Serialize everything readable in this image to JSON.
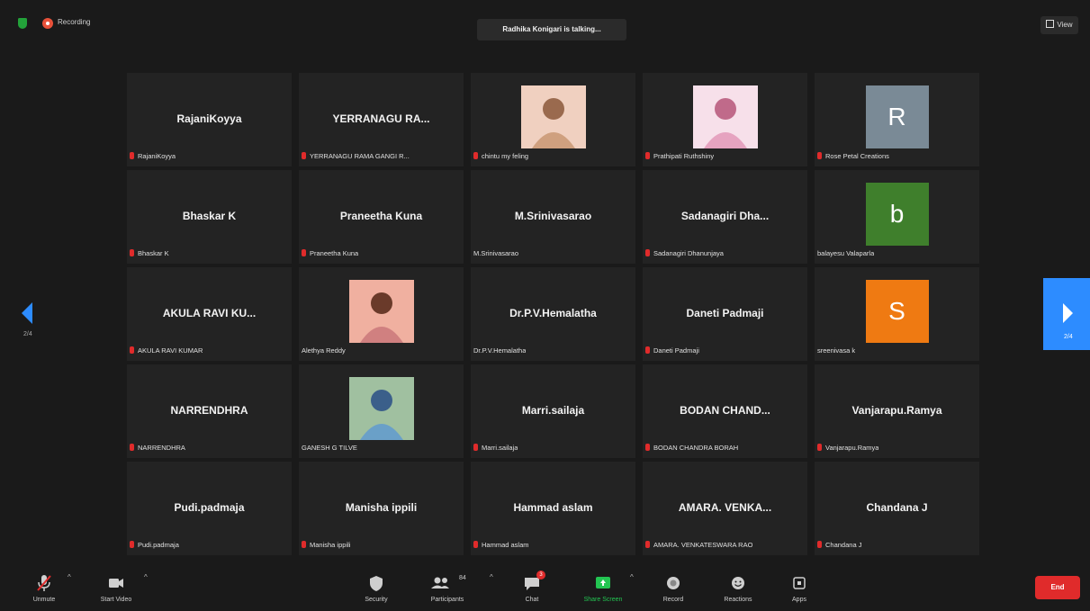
{
  "topbar": {
    "recording_label": "Recording",
    "talking_label": "Radhika Konigari is talking...",
    "view_label": "View"
  },
  "navigation": {
    "left_page": "2/4",
    "right_page": "2/4"
  },
  "tiles": [
    {
      "name": "RajaniKoyya",
      "label": "RajaniKoyya",
      "muted": true,
      "type": "name"
    },
    {
      "name": "YERRANAGU RA...",
      "label": "YERRANAGU RAMA GANGI R...",
      "muted": true,
      "type": "name"
    },
    {
      "name": "",
      "label": "chintu my feling",
      "muted": true,
      "type": "photo"
    },
    {
      "name": "",
      "label": "Prathipati Ruthshiny",
      "muted": true,
      "type": "photo"
    },
    {
      "name": "R",
      "label": "Rose Petal Creations",
      "muted": true,
      "type": "avatar",
      "color": "#7a8a96"
    },
    {
      "name": "Bhaskar K",
      "label": "Bhaskar K",
      "muted": true,
      "type": "name"
    },
    {
      "name": "Praneetha Kuna",
      "label": "Praneetha Kuna",
      "muted": true,
      "type": "name"
    },
    {
      "name": "M.Srinivasarao",
      "label": "M.Srinivasarao",
      "muted": false,
      "type": "name"
    },
    {
      "name": "Sadanagiri Dha...",
      "label": "Sadanagiri Dhanunjaya",
      "muted": true,
      "type": "name"
    },
    {
      "name": "b",
      "label": "balayesu Valaparla",
      "muted": false,
      "type": "avatar",
      "color": "#3f7f2c"
    },
    {
      "name": "AKULA RAVI KU...",
      "label": "AKULA RAVI KUMAR",
      "muted": true,
      "type": "name"
    },
    {
      "name": "",
      "label": "Alethya Reddy",
      "muted": false,
      "type": "photo"
    },
    {
      "name": "Dr.P.V.Hemalatha",
      "label": "Dr.P.V.Hemalatha",
      "muted": false,
      "type": "name"
    },
    {
      "name": "Daneti Padmaji",
      "label": "Daneti Padmaji",
      "muted": true,
      "type": "name"
    },
    {
      "name": "S",
      "label": "sreenivasa k",
      "muted": false,
      "type": "avatar",
      "color": "#ef7a12"
    },
    {
      "name": "NARRENDHRA",
      "label": "NARRENDHRA",
      "muted": true,
      "type": "name"
    },
    {
      "name": "",
      "label": "GANESH G TILVE",
      "muted": false,
      "type": "photo"
    },
    {
      "name": "Marri.sailaja",
      "label": "Marri.sailaja",
      "muted": true,
      "type": "name"
    },
    {
      "name": "BODAN CHAND...",
      "label": "BODAN CHANDRA BORAH",
      "muted": true,
      "type": "name"
    },
    {
      "name": "Vanjarapu.Ramya",
      "label": "Vanjarapu.Ramya",
      "muted": true,
      "type": "name"
    },
    {
      "name": "Pudi.padmaja",
      "label": "Pudi.padmaja",
      "muted": true,
      "type": "name"
    },
    {
      "name": "Manisha ippili",
      "label": "Manisha ippili",
      "muted": true,
      "type": "name"
    },
    {
      "name": "Hammad aslam",
      "label": "Hammad aslam",
      "muted": true,
      "type": "name"
    },
    {
      "name": "AMARA. VENKA...",
      "label": "AMARA. VENKATESWARA RAO",
      "muted": true,
      "type": "name"
    },
    {
      "name": "Chandana J",
      "label": "Chandana J",
      "muted": true,
      "type": "name"
    }
  ],
  "toolbar": {
    "unmute": "Unmute",
    "start_video": "Start Video",
    "security": "Security",
    "participants": "Participants",
    "participants_count": "84",
    "chat": "Chat",
    "chat_badge": "3",
    "share_screen": "Share Screen",
    "record": "Record",
    "reactions": "Reactions",
    "apps": "Apps",
    "end": "End"
  },
  "colors": {
    "accent_blue": "#2d8cff",
    "share_green": "#23c552",
    "end_red": "#e02b2b",
    "mute_red": "#e02b2b"
  }
}
